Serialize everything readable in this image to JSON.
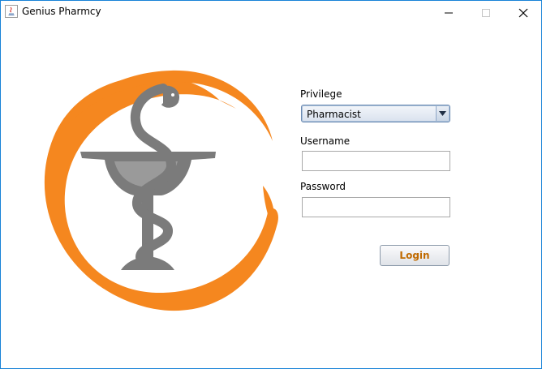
{
  "window": {
    "title": "Genius Pharmcy",
    "app_icon": "java-icon",
    "controls": [
      "minimize-icon",
      "maximize-icon",
      "close-icon"
    ]
  },
  "logo": {
    "icon": "bowl-of-hygieia-logo",
    "colors": {
      "ring": "#f5871f",
      "emblem": "#808080"
    }
  },
  "form": {
    "privilege_label": "Privilege",
    "privilege_value": "Pharmacist",
    "username_label": "Username",
    "username_value": "",
    "password_label": "Password",
    "password_value": "",
    "login_label": "Login"
  },
  "colors": {
    "login_text": "#c06a00"
  }
}
